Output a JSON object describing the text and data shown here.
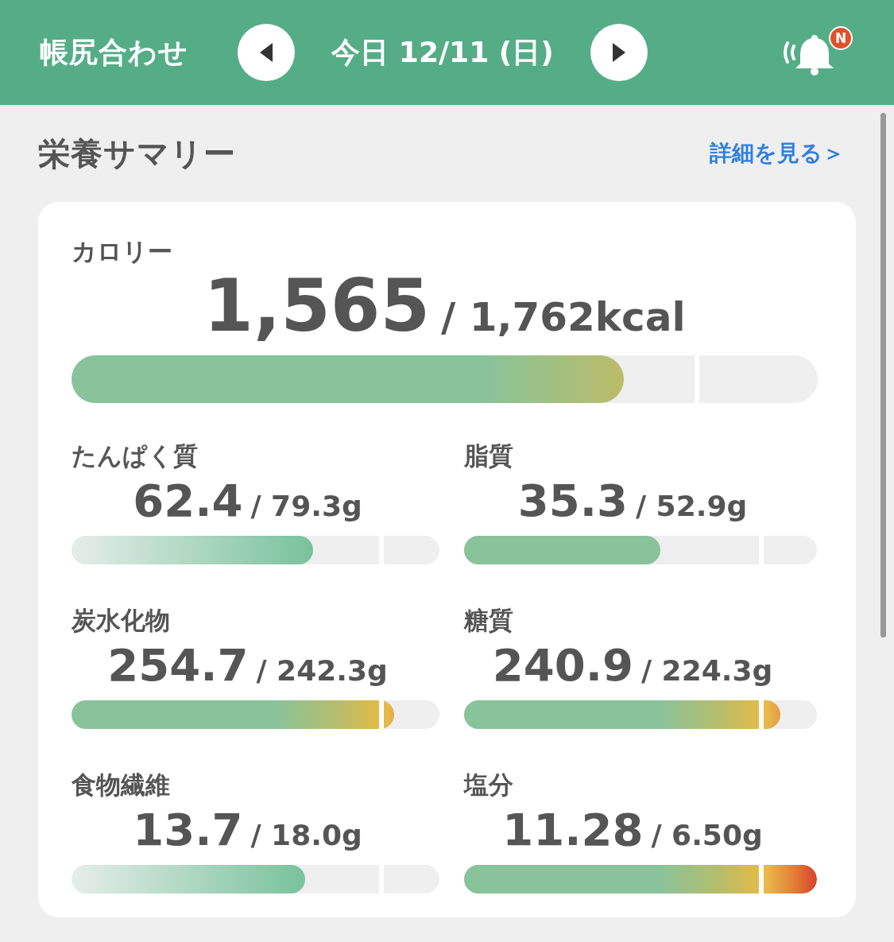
{
  "header": {
    "title": "帳尻合わせ",
    "date": "今日 12/11 (日)",
    "badge": "N"
  },
  "section": {
    "title": "栄養サマリー",
    "link": "詳細を見る＞"
  },
  "calorie": {
    "label": "カロリー",
    "value": "1,565",
    "target": "/ 1,762kcal",
    "kind": "limit",
    "level": 0.74
  },
  "nutrients": [
    {
      "label": "たんぱく質",
      "value": "62.4",
      "target": "/ 79.3g",
      "kind": "goal",
      "level": 0.657
    },
    {
      "label": "脂質",
      "value": "35.3",
      "target": "/ 52.9g",
      "kind": "limit",
      "level": 0.556
    },
    {
      "label": "炭水化物",
      "value": "254.7",
      "target": "/ 242.3g",
      "kind": "limit",
      "level": 0.877
    },
    {
      "label": "糖質",
      "value": "240.9",
      "target": "/ 224.3g",
      "kind": "limit",
      "level": 0.896
    },
    {
      "label": "食物繊維",
      "value": "13.7",
      "target": "/ 18.0g",
      "kind": "goal",
      "level": 0.635
    },
    {
      "label": "塩分",
      "value": "11.28",
      "target": "/ 6.50g",
      "kind": "limit",
      "level": 1.0
    }
  ]
}
